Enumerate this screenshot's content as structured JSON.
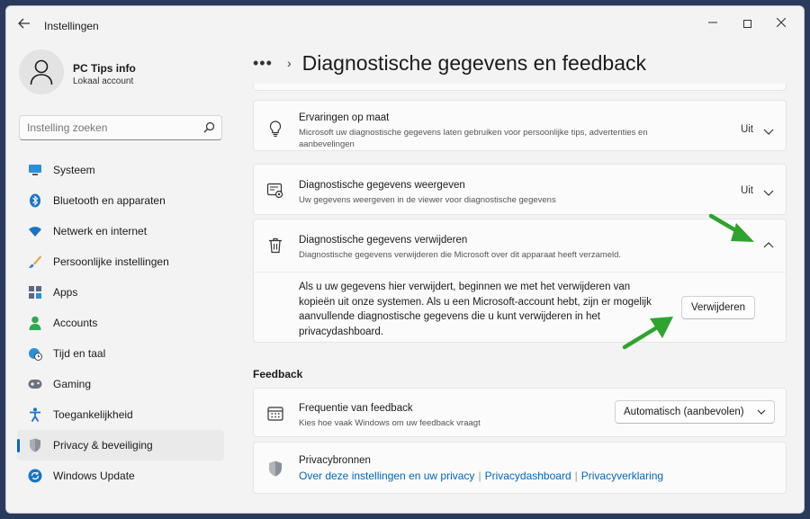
{
  "window": {
    "app_title": "Instellingen",
    "back_icon": "back-arrow-icon",
    "minimize_icon": "minimize-icon",
    "maximize_icon": "maximize-icon",
    "close_icon": "close-icon"
  },
  "profile": {
    "name": "PC Tips info",
    "account_type": "Lokaal account"
  },
  "search": {
    "placeholder": "Instelling zoeken"
  },
  "nav": [
    {
      "label": "Systeem",
      "icon": "monitor-icon"
    },
    {
      "label": "Bluetooth en apparaten",
      "icon": "bluetooth-icon"
    },
    {
      "label": "Netwerk en internet",
      "icon": "wifi-icon"
    },
    {
      "label": "Persoonlijke instellingen",
      "icon": "brush-icon"
    },
    {
      "label": "Apps",
      "icon": "apps-icon"
    },
    {
      "label": "Accounts",
      "icon": "person-icon"
    },
    {
      "label": "Tijd en taal",
      "icon": "globe-clock-icon"
    },
    {
      "label": "Gaming",
      "icon": "gamepad-icon"
    },
    {
      "label": "Toegankelijkheid",
      "icon": "accessibility-icon"
    },
    {
      "label": "Privacy & beveiliging",
      "icon": "shield-icon",
      "active": true
    },
    {
      "label": "Windows Update",
      "icon": "update-icon"
    }
  ],
  "breadcrumb": {
    "overflow": "•••",
    "separator": "›",
    "title": "Diagnostische gegevens en feedback"
  },
  "cards": {
    "tailored": {
      "title": "Ervaringen op maat",
      "description": "Microsoft uw diagnostische gegevens laten gebruiken voor persoonlijke tips, advertenties en aanbevelingen",
      "value": "Uit"
    },
    "view": {
      "title": "Diagnostische gegevens weergeven",
      "description": "Uw gegevens weergeven in de viewer voor diagnostische gegevens",
      "value": "Uit"
    },
    "delete": {
      "title": "Diagnostische gegevens verwijderen",
      "description": "Diagnostische gegevens verwijderen die Microsoft over dit apparaat heeft verzameld.",
      "body": "Als u uw gegevens hier verwijdert, beginnen we met het verwijderen van kopieën uit onze systemen. Als u een Microsoft-account hebt, zijn er mogelijk aanvullende diagnostische gegevens die u kunt verwijderen in het privacydashboard.",
      "button": "Verwijderen"
    }
  },
  "feedback": {
    "section_title": "Feedback",
    "frequency": {
      "title": "Frequentie van feedback",
      "description": "Kies hoe vaak Windows om uw feedback vraagt",
      "selected": "Automatisch (aanbevolen)"
    },
    "privacy": {
      "title": "Privacybronnen",
      "links": [
        "Over deze instellingen en uw privacy",
        "Privacydashboard",
        "Privacyverklaring"
      ]
    }
  },
  "colors": {
    "accent": "#0067c0",
    "annotation_arrow": "#2ea32e"
  }
}
